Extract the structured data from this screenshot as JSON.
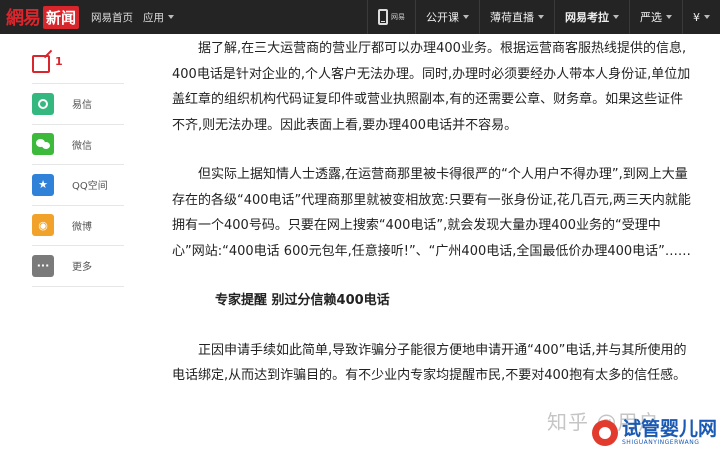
{
  "header": {
    "logo_part1": "網易",
    "logo_part2": "新闻",
    "nav_home": "网易首页",
    "nav_apps": "应用",
    "right_nav": [
      {
        "label": "公开课",
        "bold": false
      },
      {
        "label": "薄荷直播",
        "bold": false
      },
      {
        "label": "网易考拉",
        "bold": true
      },
      {
        "label": "严选",
        "bold": false
      },
      {
        "label": "¥",
        "bold": false
      }
    ],
    "phone_label": "网易"
  },
  "sidebar": {
    "comment_count": "1",
    "share_items": [
      {
        "label": "易信",
        "icon": "yixin-icon"
      },
      {
        "label": "微信",
        "icon": "wechat-icon"
      },
      {
        "label": "QQ空间",
        "icon": "qzone-icon"
      },
      {
        "label": "微博",
        "icon": "weibo-icon"
      },
      {
        "label": "更多",
        "icon": "more-icon"
      }
    ]
  },
  "article": {
    "p1": "据了解,在三大运营商的营业厅都可以办理400业务。根据运营商客服热线提供的信息, 400电话是针对企业的,个人客户无法办理。同时,办理时必须要经办人带本人身份证,单位加盖红章的组织机构代码证复印件或营业执照副本,有的还需要公章、财务章。如果这些证件不齐,则无法办理。因此表面上看,要办理400电话并不容易。",
    "p2": "但实际上据知情人士透露,在运营商那里被卡得很严的“个人用户不得办理”,到网上大量存在的各级“400电话”代理商那里就被变相放宽:只要有一张身份证,花几百元,两三天内就能拥有一个400号码。只要在网上搜索“400电话”,就会发现大量办理400业务的“受理中心”网站:“400电话 600元包年,任意接听!”、“广州400电话,全国最低价办理400电话”……",
    "subhead": "专家提醒 别过分信赖400电话",
    "p3": "正因申请手续如此简单,导致诈骗分子能很方便地申请开通“400”电话,并与其所使用的电话绑定,从而达到诈骗目的。有不少业内专家均提醒市民,不要对400抱有太多的信任感。"
  },
  "watermark": {
    "zhihu": "知乎 @用户",
    "brand_title": "试管婴儿网",
    "brand_sub": "SHIGUANYINGERWANG"
  },
  "colors": {
    "accent": "#d8262c",
    "topbar": "#242424"
  }
}
